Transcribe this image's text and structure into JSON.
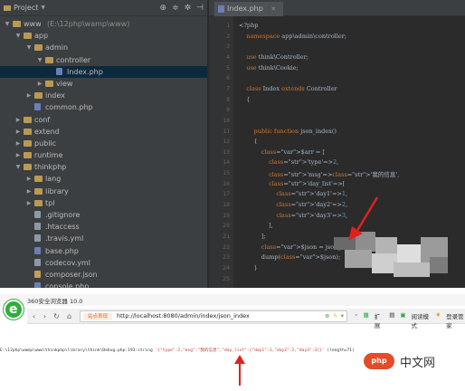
{
  "ide": {
    "panel_title": "Project",
    "tree": [
      {
        "label": "www",
        "path": "(E:\\12php\\wamp\\www)",
        "type": "folder",
        "depth": 0,
        "open": true
      },
      {
        "label": "app",
        "type": "folder",
        "depth": 1,
        "open": true
      },
      {
        "label": "admin",
        "type": "folder",
        "depth": 2,
        "open": true
      },
      {
        "label": "controller",
        "type": "folder",
        "depth": 3,
        "open": true
      },
      {
        "label": "Index.php",
        "type": "php",
        "depth": 4,
        "selected": true
      },
      {
        "label": "view",
        "type": "folder",
        "depth": 3,
        "open": false
      },
      {
        "label": "index",
        "type": "folder",
        "depth": 2,
        "open": false
      },
      {
        "label": "common.php",
        "type": "php",
        "depth": 2
      },
      {
        "label": "conf",
        "type": "folder",
        "depth": 1,
        "open": false
      },
      {
        "label": "extend",
        "type": "folder",
        "depth": 1,
        "open": false
      },
      {
        "label": "public",
        "type": "folder",
        "depth": 1,
        "open": false
      },
      {
        "label": "runtime",
        "type": "folder",
        "depth": 1,
        "open": false
      },
      {
        "label": "thinkphp",
        "type": "folder",
        "depth": 1,
        "open": true
      },
      {
        "label": "lang",
        "type": "folder",
        "depth": 2,
        "open": false
      },
      {
        "label": "library",
        "type": "folder",
        "depth": 2,
        "open": false
      },
      {
        "label": "tpl",
        "type": "folder",
        "depth": 2,
        "open": false
      },
      {
        "label": ".gitignore",
        "type": "txt",
        "depth": 2
      },
      {
        "label": ".htaccess",
        "type": "txt",
        "depth": 2
      },
      {
        "label": ".travis.yml",
        "type": "txt",
        "depth": 2
      },
      {
        "label": "base.php",
        "type": "php",
        "depth": 2
      },
      {
        "label": "codecov.yml",
        "type": "txt",
        "depth": 2
      },
      {
        "label": "composer.json",
        "type": "json",
        "depth": 2
      },
      {
        "label": "console.php",
        "type": "php",
        "depth": 2
      }
    ],
    "tab_label": "Index.php",
    "line_numbers": [
      "1",
      "2",
      "3",
      "4",
      "5",
      "6",
      "7",
      "8",
      "9",
      "10",
      "11",
      "12",
      "13",
      "14",
      "15",
      "16",
      "17",
      "18",
      "19",
      "20",
      "21",
      "22",
      "23",
      "24",
      "25"
    ],
    "code_lines": [
      "<?php",
      "    namespace app\\admin\\controller;",
      "",
      "    use think\\Controller;",
      "    use think\\Cookie;",
      "",
      "    class Index extends Controller",
      "    {",
      "",
      "",
      "        public function json_index()",
      "        {",
      "            $arr = [",
      "                'type'=>2,",
      "                'msg'=>'我的信息',",
      "                'day_list'=>[",
      "                    'day1'=>1,",
      "                    'day2'=>2,",
      "                    'day3'=>3,",
      "                ],",
      "            ];",
      "            $json = json_encod",
      "            dump($json);",
      "        }",
      ""
    ]
  },
  "browser": {
    "title": "360安全浏览器 10.0",
    "cert_label": "站点表现",
    "url": "http://localhost:8080/admin/index/json_index",
    "right_items": [
      "扩展",
      "阅读模式",
      "登录管家"
    ],
    "output_prefix": "E:\\12php\\wamp\\www\\thinkphp\\library\\think\\Debug.php:193:string ",
    "output_json": "'{\"type\":2,\"msg\":\"我的信息\",\"day_list\":{\"day1\":1,\"day2\":2,\"day3\":3}}'",
    "output_suffix": " (length=71)"
  },
  "watermark": {
    "logo": "php",
    "text": "中文网"
  }
}
